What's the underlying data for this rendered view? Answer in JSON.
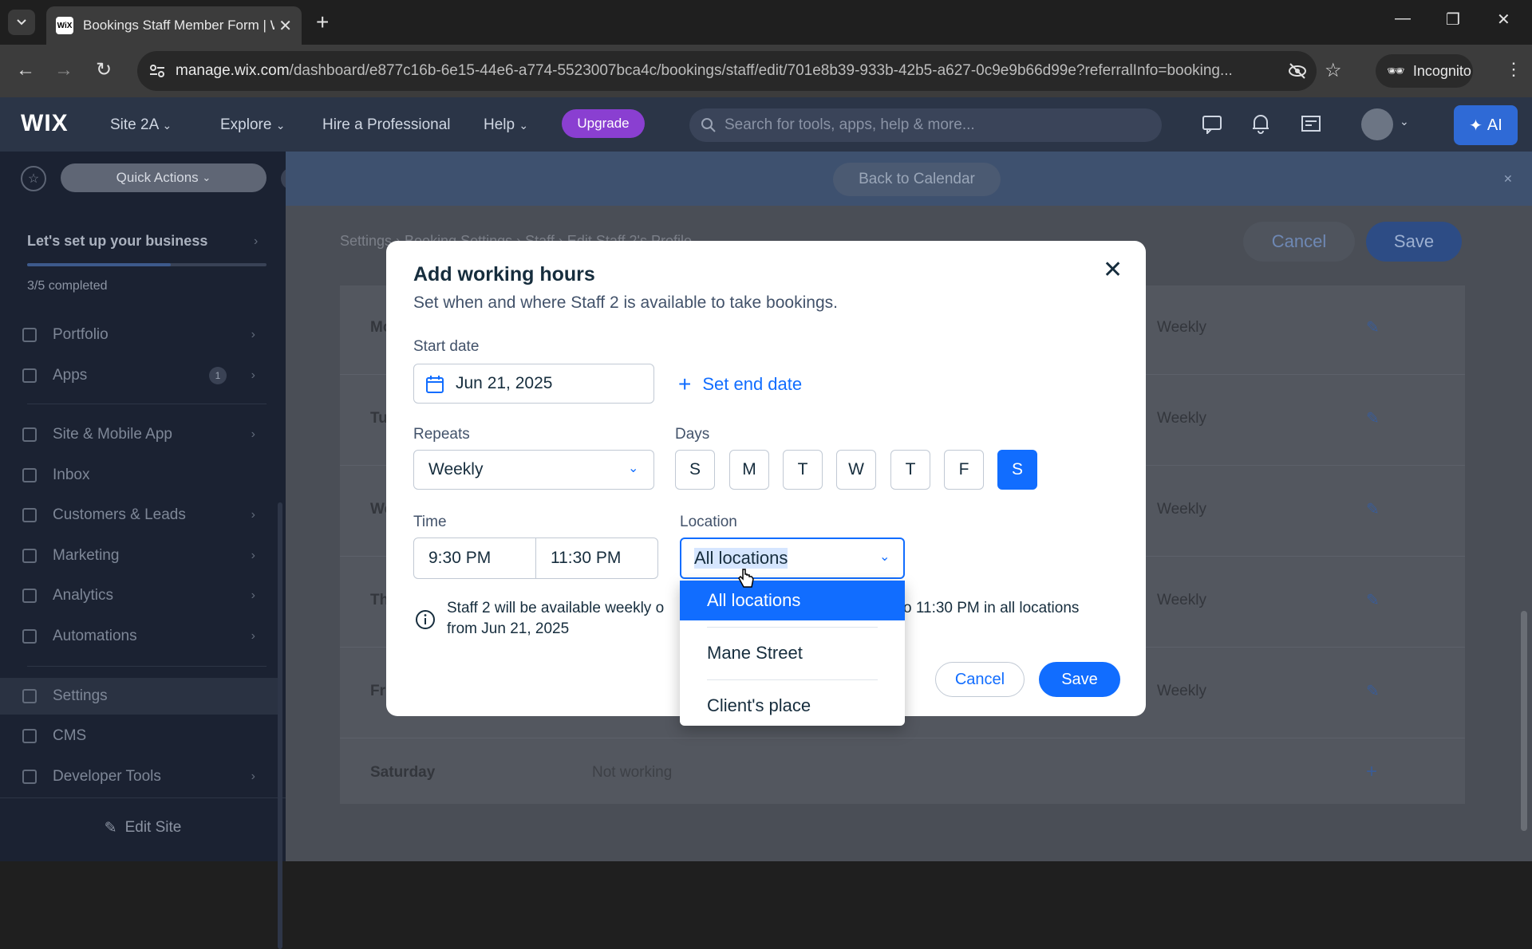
{
  "browser": {
    "tab_title": "Bookings Staff Member Form | W",
    "tab_favicon": "WiX",
    "url_host": "manage.wix.com",
    "url_path": "/dashboard/e877c16b-6e15-44e6-a774-5523007bca4c/bookings/staff/edit/701e8b39-933b-42b5-a627-0c9e9b66d99e?referralInfo=booking...",
    "incognito_label": "Incognito",
    "icons": [
      "tab-list-icon",
      "close-icon",
      "plus-icon",
      "minimize-icon",
      "restore-icon",
      "close-window-icon",
      "back-icon",
      "forward-icon",
      "reload-icon",
      "site-info-icon",
      "eye-off-icon",
      "star-icon",
      "incognito-icon",
      "menu-icon"
    ]
  },
  "wix_header": {
    "logo": "WIX",
    "site_name": "Site 2A",
    "nav": [
      "Explore",
      "Hire a Professional",
      "Help"
    ],
    "upgrade_label": "Upgrade",
    "search_placeholder": "Search for tools, apps, help & more...",
    "ai_label": "AI",
    "accent": "#116dff",
    "upgrade_color": "#8a3fd1"
  },
  "sidebar": {
    "quick_actions": "Quick Actions",
    "setup_title": "Let's set up your business",
    "setup_progress": "3/5 completed",
    "setup_progress_fraction": 0.6,
    "items": [
      {
        "label": "Portfolio",
        "chevron": true
      },
      {
        "label": "Apps",
        "badge": "1",
        "chevron": true
      },
      {
        "label": "Site & Mobile App",
        "chevron": true
      },
      {
        "label": "Inbox",
        "chevron": false
      },
      {
        "label": "Customers & Leads",
        "chevron": true
      },
      {
        "label": "Marketing",
        "chevron": true
      },
      {
        "label": "Analytics",
        "chevron": true
      },
      {
        "label": "Automations",
        "chevron": true
      },
      {
        "label": "Settings",
        "chevron": false
      },
      {
        "label": "CMS",
        "chevron": false
      },
      {
        "label": "Developer Tools",
        "chevron": true
      }
    ],
    "edit_site": "Edit Site"
  },
  "page": {
    "back_to_calendar": "Back to Calendar",
    "breadcrumb": "Settings  ›  Booking Settings  ›  Staff  ›  Edit Staff 2's Profile",
    "cancel": "Cancel",
    "save": "Save",
    "rows": [
      {
        "day": "Mo",
        "repeat": "Weekly"
      },
      {
        "day": "Tu",
        "repeat": "Weekly"
      },
      {
        "day": "We",
        "repeat": "Weekly"
      },
      {
        "day": "Th",
        "repeat": "Weekly"
      },
      {
        "day": "Fri",
        "repeat": "Weekly"
      }
    ],
    "saturday": {
      "day": "Saturday",
      "status": "Not working"
    }
  },
  "modal": {
    "title": "Add working hours",
    "subtitle": "Set when and where Staff 2 is available to take bookings.",
    "start_date_label": "Start date",
    "start_date": "Jun 21, 2025",
    "set_end_date": "Set end date",
    "repeats_label": "Repeats",
    "repeats_value": "Weekly",
    "days_label": "Days",
    "days": [
      "S",
      "M",
      "T",
      "W",
      "T",
      "F",
      "S"
    ],
    "selected_day_index": 6,
    "time_label": "Time",
    "time_start": "9:30 PM",
    "time_end": "11:30 PM",
    "location_label": "Location",
    "location_value": "All locations",
    "info_text_1": "Staff 2 will be available weekly o",
    "info_text_2": "o 11:30 PM in all locations",
    "info_text_3": "from Jun 21, 2025",
    "cancel": "Cancel",
    "save": "Save"
  },
  "dropdown": {
    "options": [
      "All locations",
      "Mane Street",
      "Client's place"
    ],
    "selected_index": 0
  }
}
